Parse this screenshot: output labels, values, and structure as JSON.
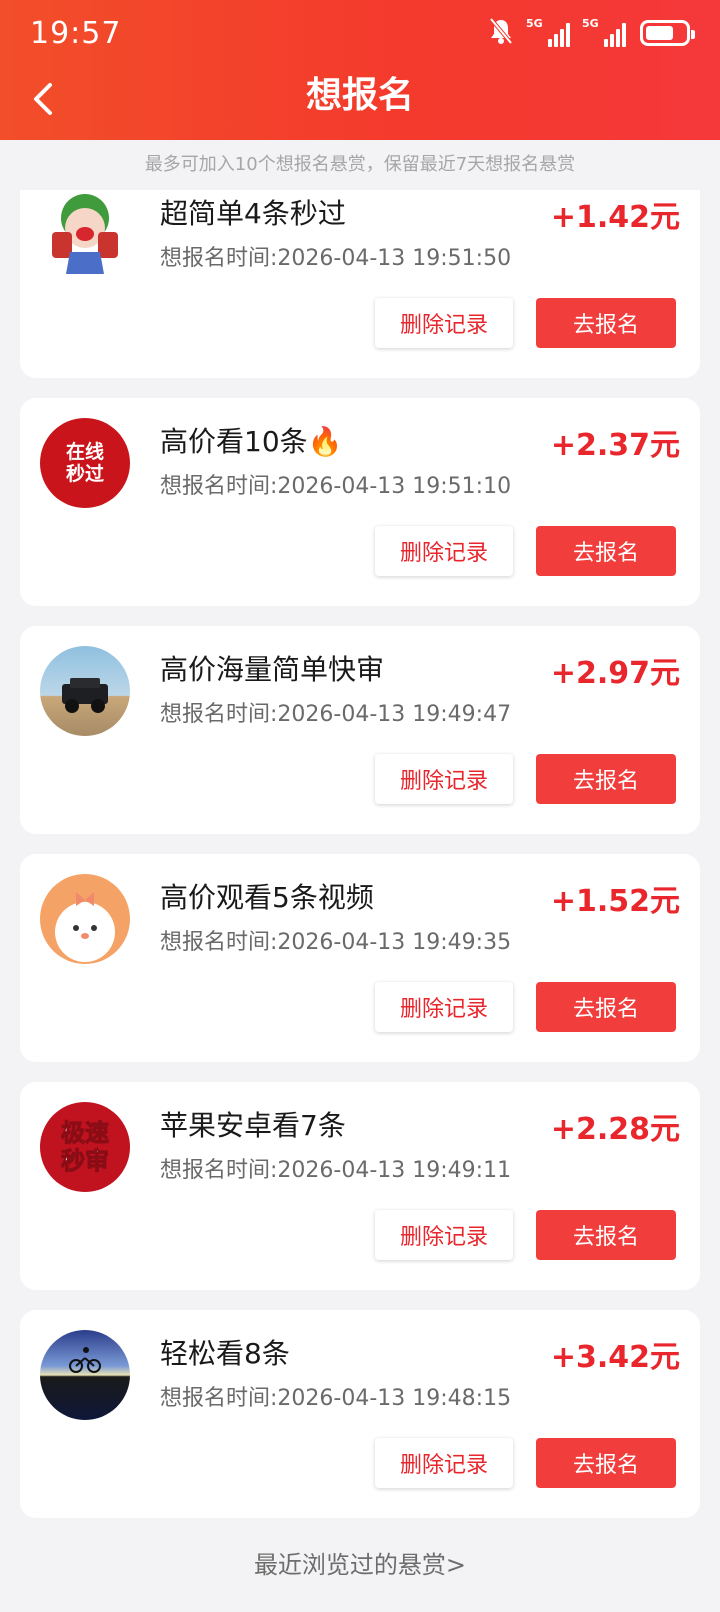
{
  "status": {
    "time": "19:57",
    "signal1": "5G",
    "signal2": "5G"
  },
  "nav": {
    "title": "想报名"
  },
  "notice": "最多可加入10个想报名悬赏，保留最近7天想报名悬赏",
  "buttons": {
    "delete": "删除记录",
    "apply": "去报名"
  },
  "cards": [
    {
      "title": "超简单4条秒过",
      "time": "想报名时间:2026-04-13 19:51:50",
      "reward": "+1.42元",
      "avatar_icon": "cartoon-girl-icon"
    },
    {
      "title": "高价看10条🔥",
      "time": "想报名时间:2026-04-13 19:51:10",
      "reward": "+2.37元",
      "avatar_icon": "zaixian-miaoguo-badge",
      "avatar_text": "在线\n秒过"
    },
    {
      "title": "高价海量简单快审",
      "time": "想报名时间:2026-04-13 19:49:47",
      "reward": "+2.97元",
      "avatar_icon": "offroad-vehicle-photo"
    },
    {
      "title": "高价观看5条视频",
      "time": "想报名时间:2026-04-13 19:49:35",
      "reward": "+1.52元",
      "avatar_icon": "cute-bunny-icon"
    },
    {
      "title": "苹果安卓看7条",
      "time": "想报名时间:2026-04-13 19:49:11",
      "reward": "+2.28元",
      "avatar_icon": "jisu-miaoshen-badge",
      "avatar_text": "极速\n秒审"
    },
    {
      "title": "轻松看8条",
      "time": "想报名时间:2026-04-13 19:48:15",
      "reward": "+3.42元",
      "avatar_icon": "cyclist-sunset-photo"
    }
  ],
  "footer": {
    "recent_link": "最近浏览过的悬赏>"
  },
  "colors": {
    "header": "#f43a2c",
    "accent": "#e8262c",
    "apply_button": "#f23d3d"
  }
}
